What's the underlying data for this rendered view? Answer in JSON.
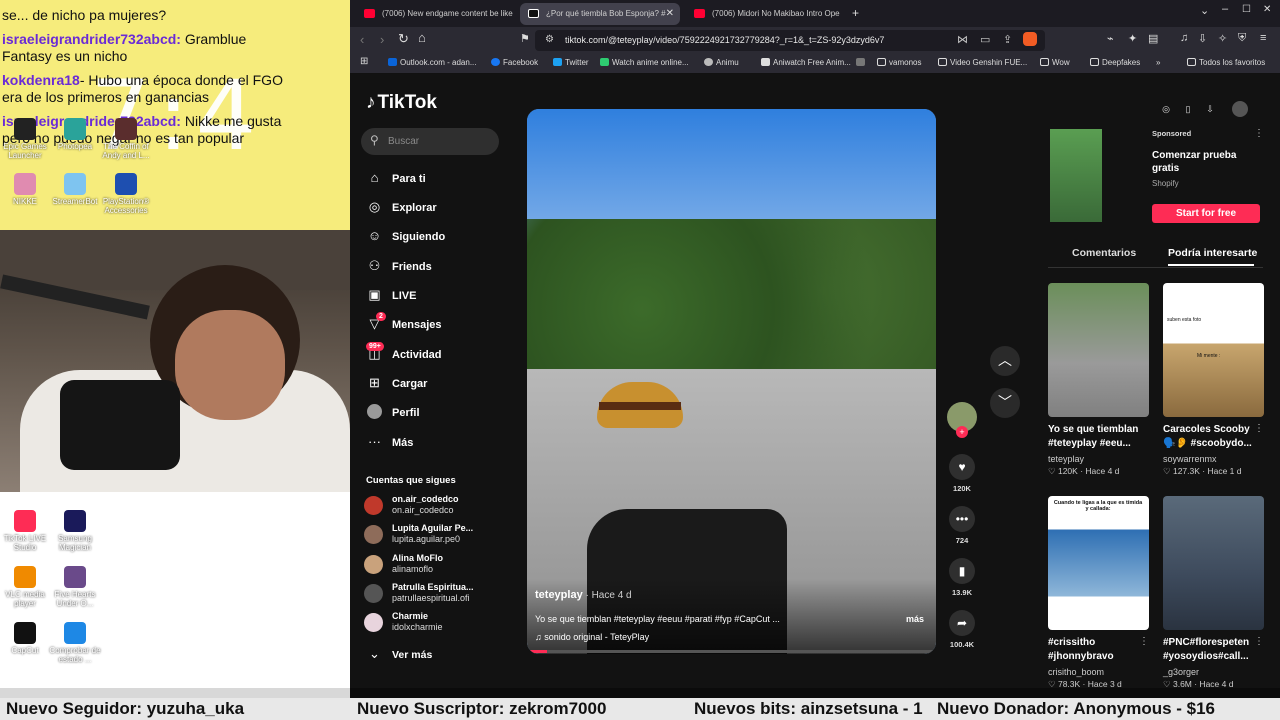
{
  "stream": {
    "clock": "7:4",
    "chat": [
      {
        "nick": "",
        "text": "se... de nicho pa mujeres?"
      },
      {
        "nick": "israeleigrandrider732abcd:",
        "text": "Gramblue"
      },
      {
        "nick": "",
        "text": "Fantasy es un nicho"
      },
      {
        "nick": "kokdenra18",
        "text": "- Hubo una época donde el FGO"
      },
      {
        "nick": "",
        "text": "era de los primeros en ganancias"
      },
      {
        "nick": "israeleigrandrider732abcd:",
        "text": "Nikke me gusta"
      },
      {
        "nick": "",
        "text": "pero no puedo negar no es tan popular"
      }
    ],
    "desktop_icons_top": [
      "NIKKE",
      "StreamerBot",
      "PlayStation® Accessories",
      "Epic Games Launcher",
      "Photopea",
      "The Coffin of Andy and L..."
    ],
    "desktop_icons_bottom": [
      "TikTok LIVE Studio",
      "Samsung Magician",
      "VLC media player",
      "Five Hearts Under O...",
      "CapCut",
      "Comprobar de estado ..."
    ]
  },
  "ticker": {
    "follower": "Nuevo Seguidor: yuzuha_uka",
    "subscriber": "Nuevo Suscriptor: zekrom7000",
    "bits": "Nuevos bits: ainzsetsuna - 1",
    "donor": "Nuevo Donador: Anonymous - $16"
  },
  "browser": {
    "tabs": [
      {
        "title": "(7006) New endgame content be like",
        "color": "#ff0033"
      },
      {
        "title": "¿Por qué tiembla Bob Esponja? #",
        "color": "#ffffff"
      },
      {
        "title": "(7006) Midori No Makibao Intro Ope",
        "color": "#ff0033"
      }
    ],
    "url": "tiktok.com/@teteyplay/video/7592224921732779284?_r=1&_t=ZS-92y3dzyd6v7",
    "bookmarks": [
      "Outlook.com - adan...",
      "Facebook",
      "Twitter",
      "Watch anime online...",
      "Animu",
      "Aniwatch Free Anim...",
      "vamonos",
      "Video Genshin FUE...",
      "Wow",
      "Deepfakes",
      "Todos los favoritos"
    ]
  },
  "tiktok": {
    "logo": "TikTok",
    "search_placeholder": "Buscar",
    "nav": [
      "Para ti",
      "Explorar",
      "Siguiendo",
      "Friends",
      "LIVE",
      "Mensajes",
      "Actividad",
      "Cargar",
      "Perfil",
      "Más"
    ],
    "nav_icons": [
      "home-icon",
      "compass-icon",
      "following-icon",
      "friends-icon",
      "live-icon",
      "messages-icon",
      "activity-icon",
      "upload-icon",
      "profile-icon",
      "more-icon"
    ],
    "badges": {
      "messages": "2",
      "activity": "99+"
    },
    "following_title": "Cuentas que sigues",
    "following": [
      {
        "name": "on.air_codedco",
        "handle": "on.air_codedco",
        "color": "#c0392b"
      },
      {
        "name": "Lupita Aguilar Pe...",
        "handle": "lupita.aguilar.pe0",
        "color": "#8e6c5a"
      },
      {
        "name": "Alina MoFlo",
        "handle": "alinamoflo",
        "color": "#c9a27c"
      },
      {
        "name": "Patrulla Espiritua...",
        "handle": "patrullaespiritual.ofi",
        "color": "#555555"
      },
      {
        "name": "Charmie",
        "handle": "idolxcharmie",
        "color": "#e8d4dd"
      }
    ],
    "see_more": "Ver más",
    "video": {
      "author": "teteyplay",
      "time": " · Hace 4 d",
      "description": "Yo se que tiemblan #teteyplay #eeuu #parati #fyp #CapCut ...",
      "more": "más",
      "sound": "sonido original - TeteyPlay",
      "progress": 0.05
    },
    "actions": {
      "likes": "120K",
      "comments": "724",
      "saves": "13.9K",
      "shares": "100.4K"
    },
    "ad": {
      "sponsored": "Sponsored",
      "title": "Comenzar prueba gratis",
      "brand": "Shopify",
      "button": "Start for free"
    },
    "right_tabs": {
      "comments": "Comentarios",
      "suggested": "Podría interesarte"
    },
    "cards": [
      {
        "title": "Yo se que tiemblan #teteyplay #eeu...",
        "author": "teteyplay",
        "stats": "♡ 120K · Hace 4 d",
        "bg": "#6b8f5a"
      },
      {
        "title": "Caracoles Scooby 🗣️👂 #scoobydo...",
        "author": "soywarrenmx",
        "stats": "♡ 127.3K · Hace 1 d",
        "bg": "#d8d8d8"
      },
      {
        "title": "#crissitho #jhonnybravo",
        "author": "crisitho_boom",
        "stats": "♡ 78.3K · Hace 3 d",
        "bg": "#2e6fb3"
      },
      {
        "title": "#PNC#florespeten #yosoydios#call...",
        "author": "_g3orger",
        "stats": "♡ 3.6M · Hace 4 d",
        "bg": "#3d4a5c"
      }
    ],
    "card_captions": {
      "scooby_top": "suben esta foto",
      "scooby_mid": "Mi mente :",
      "cris_top": "Cuando te ligas a la que es tímida y callada:"
    }
  }
}
